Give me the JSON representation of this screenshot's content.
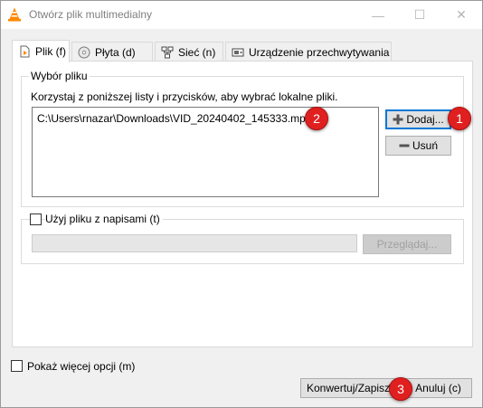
{
  "window": {
    "title": "Otwórz plik multimedialny"
  },
  "titlebar_buttons": {
    "minimize": "—",
    "maximize": "☐",
    "close": "✕"
  },
  "tabs": [
    {
      "label": "Plik (f)",
      "icon": "file-icon",
      "active": true
    },
    {
      "label": "Płyta (d)",
      "icon": "disc-icon",
      "active": false
    },
    {
      "label": "Sieć (n)",
      "icon": "network-icon",
      "active": false
    },
    {
      "label": "Urządzenie przechwytywania",
      "icon": "capture-device-icon",
      "active": false
    }
  ],
  "file_selection": {
    "group_title": "Wybór pliku",
    "hint": "Korzystaj z poniższej listy i przycisków, aby wybrać lokalne pliki.",
    "files": [
      "C:\\Users\\rnazar\\Downloads\\VID_20240402_145333.mp4"
    ],
    "add_button": "Dodaj...",
    "remove_button": "Usuń"
  },
  "subtitles": {
    "checkbox_label": "Użyj pliku z napisami (t)",
    "checked": false,
    "path_value": "",
    "browse_button": "Przeglądaj..."
  },
  "footer": {
    "more_options_label": "Pokaż więcej opcji (m)",
    "convert_button": "Konwertuj/Zapisz",
    "cancel_button": "Anuluj (c)"
  },
  "markers": [
    "1",
    "2",
    "3"
  ],
  "colors": {
    "marker": "#e02020",
    "focus_border": "#0078d7",
    "vlc_orange": "#ff8800"
  }
}
